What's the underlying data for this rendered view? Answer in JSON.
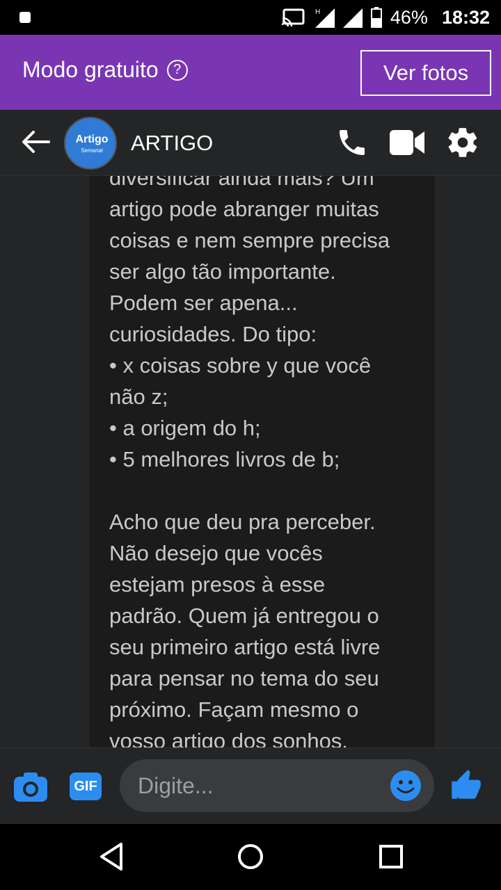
{
  "status_bar": {
    "battery": "46%",
    "time": "18:32",
    "icons": [
      "notification-icon",
      "cast-icon",
      "signal-h-icon",
      "signal-icon",
      "battery-icon"
    ]
  },
  "promo": {
    "label": "Modo gratuito",
    "help_icon": "?",
    "button": "Ver fotos",
    "color": "#7a35b3"
  },
  "header": {
    "title": "ARTIGO",
    "avatar_text": "Artigo",
    "avatar_sub": "Semanal",
    "icons": [
      "back-arrow-icon",
      "phone-icon",
      "video-icon",
      "gear-icon"
    ]
  },
  "message": {
    "text": "diversificar ainda mais? Um\nartigo pode abranger muitas\ncoisas e nem sempre precisa\nser algo tão importante.\nPodem ser apena...\ncuriosidades. Do tipo:\n• x coisas sobre y que você\nnão z;\n• a origem do h;\n• 5 melhores livros de b;\n\nAcho que deu pra perceber.\nNão desejo que vocês\nestejam presos à esse\npadrão. Quem já entregou o\nseu primeiro artigo está livre\npara pensar no tema do seu\npróximo. Façam mesmo o\nvosso artigo dos sonhos."
  },
  "composer": {
    "placeholder": "Digite...",
    "gif_label": "GIF",
    "accent": "#2d8cf0",
    "icons": [
      "camera-icon",
      "gif-icon",
      "emoji-icon",
      "thumbs-up-icon"
    ]
  },
  "nav": {
    "icons": [
      "back-triangle-icon",
      "home-circle-icon",
      "recents-square-icon"
    ]
  }
}
